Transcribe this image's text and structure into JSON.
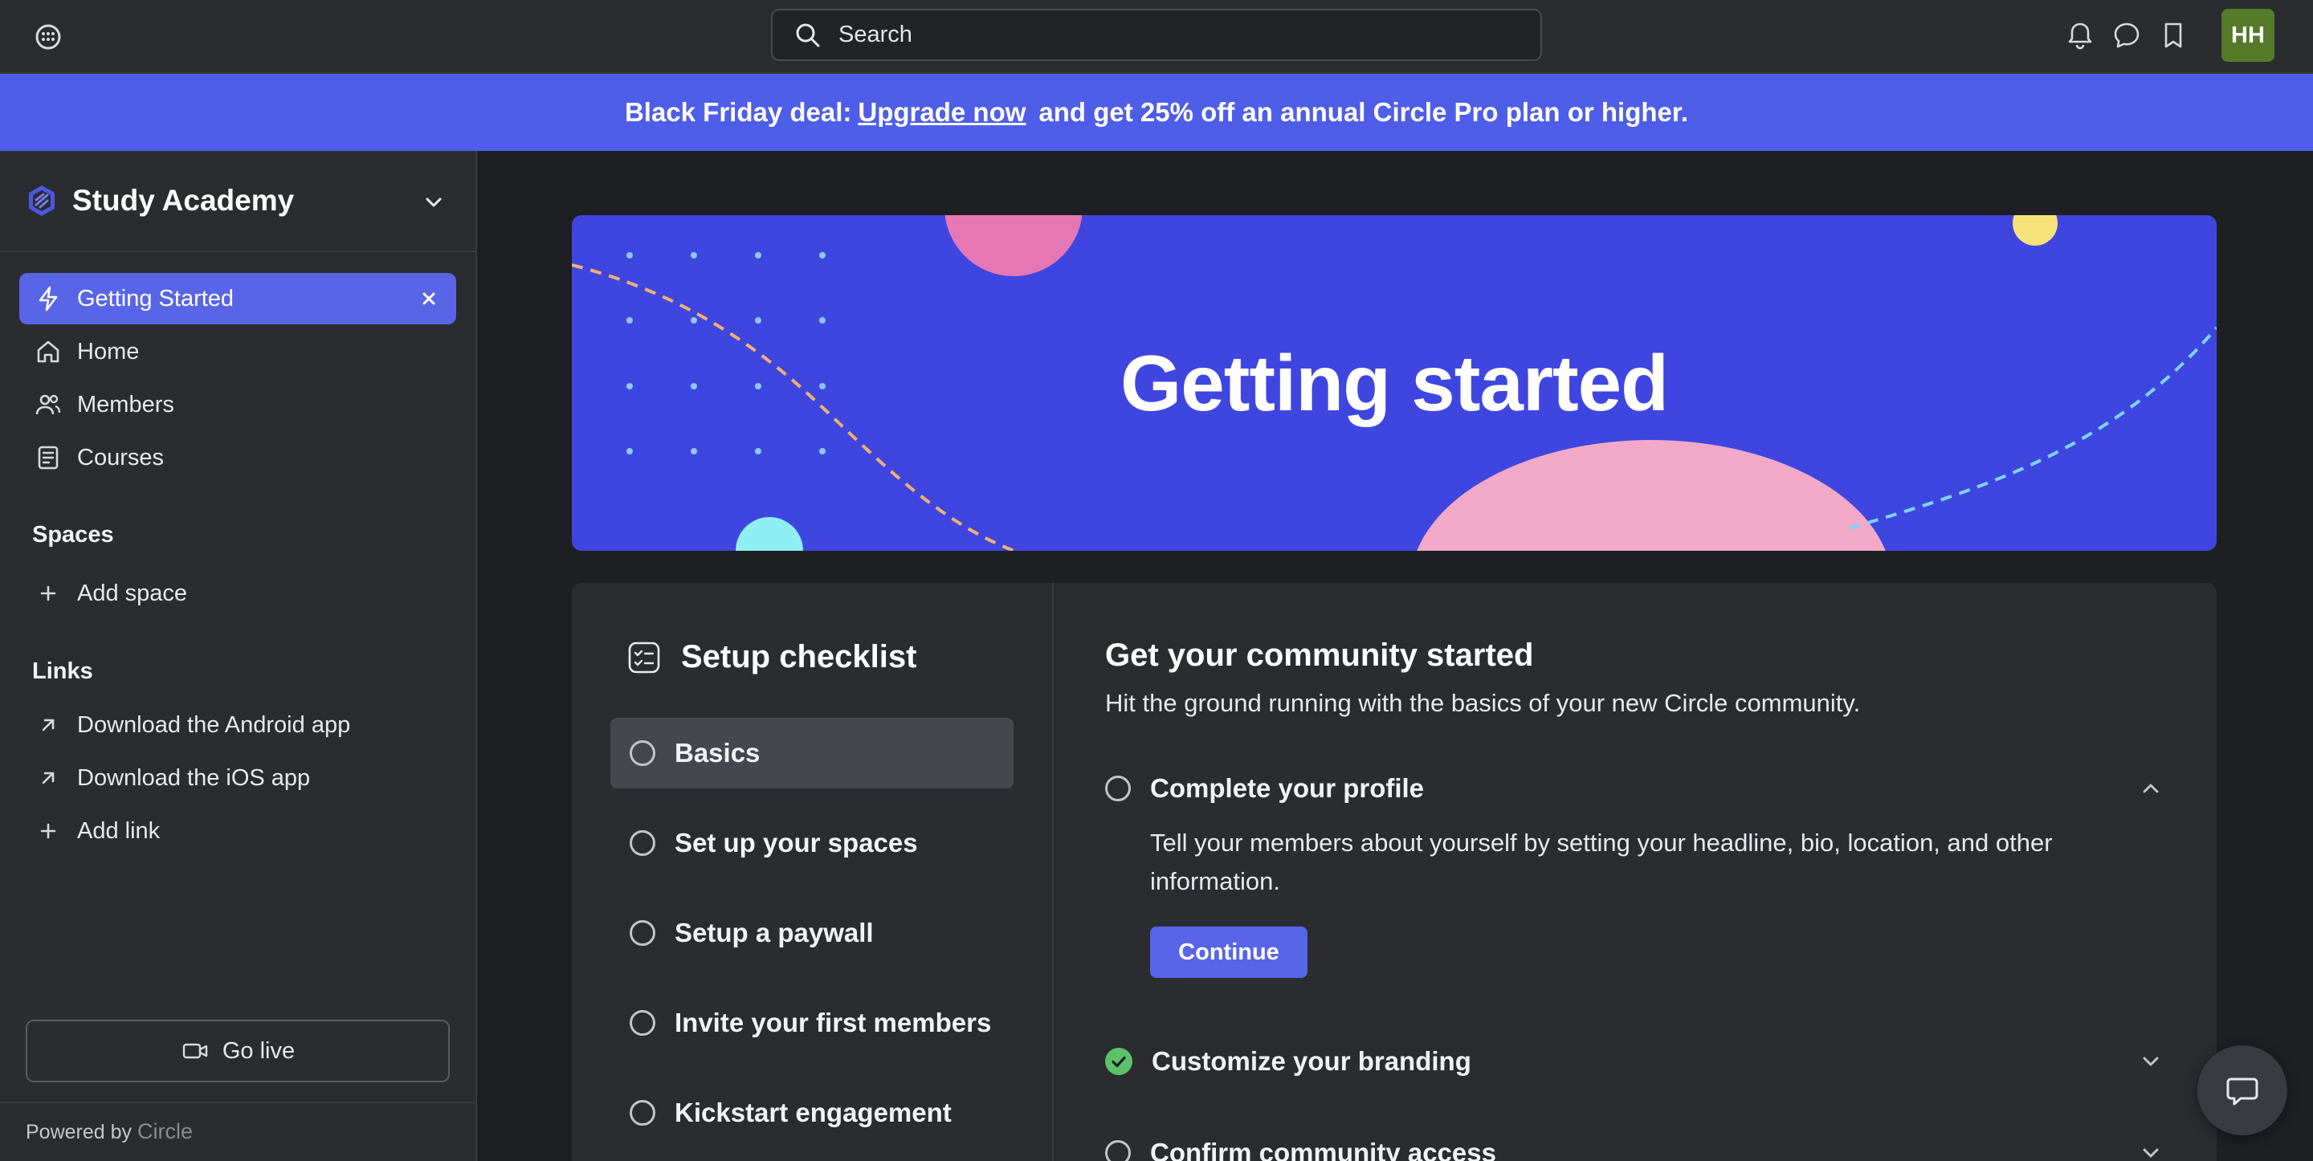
{
  "search": {
    "placeholder": "Search"
  },
  "user": {
    "initials": "HH"
  },
  "banner": {
    "lead": "Black Friday deal:",
    "link": "Upgrade now",
    "tail": "and get 25% off an annual Circle Pro plan or higher."
  },
  "community": {
    "name": "Study Academy"
  },
  "nav": {
    "items": [
      {
        "label": "Getting Started",
        "icon": "lightning-icon",
        "active": true
      },
      {
        "label": "Home",
        "icon": "home-icon"
      },
      {
        "label": "Members",
        "icon": "members-icon"
      },
      {
        "label": "Courses",
        "icon": "courses-icon"
      }
    ]
  },
  "spaces": {
    "heading": "Spaces",
    "add_label": "Add space"
  },
  "links": {
    "heading": "Links",
    "items": [
      {
        "label": "Download the Android app"
      },
      {
        "label": "Download the iOS app"
      }
    ],
    "add_label": "Add link"
  },
  "sidebar_footer": {
    "go_live": "Go live",
    "powered_by": "Powered by",
    "brand": "Circle"
  },
  "hero": {
    "title": "Getting started"
  },
  "checklist": {
    "title": "Setup checklist",
    "steps": [
      {
        "label": "Basics",
        "active": true
      },
      {
        "label": "Set up your spaces"
      },
      {
        "label": "Setup a paywall"
      },
      {
        "label": "Invite your first members"
      },
      {
        "label": "Kickstart engagement"
      }
    ]
  },
  "detail": {
    "title": "Get your community started",
    "subtitle": "Hit the ground running with the basics of your new Circle community.",
    "tasks": [
      {
        "label": "Complete your profile",
        "done": false,
        "expanded": true,
        "description": "Tell your members about yourself by setting your headline, bio, location, and other information.",
        "button": "Continue"
      },
      {
        "label": "Customize your branding",
        "done": true,
        "expanded": false
      },
      {
        "label": "Confirm community access",
        "done": false,
        "expanded": false
      }
    ]
  },
  "colors": {
    "accent": "#5865e6",
    "banner": "#4f5ee8",
    "hero": "#3f46e0",
    "success": "#5cc26a",
    "avatar": "#557a2a"
  }
}
